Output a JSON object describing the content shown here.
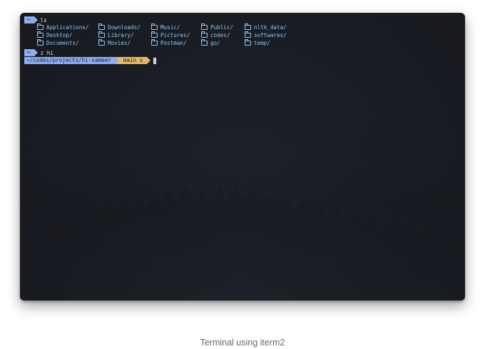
{
  "terminal": {
    "prompt_symbol": "~",
    "first_command": "ls",
    "ls_entries": [
      [
        "Applications/",
        "Downloads/",
        "Music/",
        "Public/",
        "nltk_data/"
      ],
      [
        "Desktop/",
        "Library/",
        "Pictures/",
        "codes/",
        "softwares/"
      ],
      [
        "Documents/",
        "Movies/",
        "Postman/",
        "go/",
        "temp/"
      ]
    ],
    "second_command": "z hi",
    "current_path": "~/codes/projects/hi-sameer",
    "branch_icon": "",
    "branch_name": "main ±"
  },
  "caption": "Terminal using iterm2",
  "colors": {
    "prompt_bg": "#8aaef0",
    "branch_bg": "#e6b96a",
    "directory_text": "#8fc6f0",
    "terminal_bg": "#1c1f26"
  },
  "icons": {
    "folder": "folder-icon",
    "git_branch": "git-branch-icon"
  }
}
